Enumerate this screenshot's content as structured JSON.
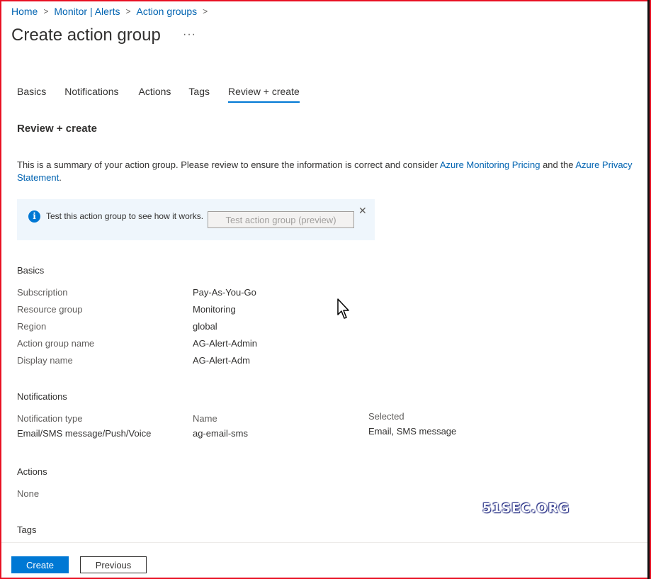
{
  "breadcrumb": {
    "items": [
      "Home",
      "Monitor | Alerts",
      "Action groups"
    ],
    "separator": ">"
  },
  "page": {
    "title": "Create action group",
    "more_label": "···"
  },
  "tabs": [
    {
      "label": "Basics",
      "active": false
    },
    {
      "label": "Notifications",
      "active": false
    },
    {
      "label": "Actions",
      "active": false
    },
    {
      "label": "Tags",
      "active": false
    },
    {
      "label": "Review + create",
      "active": true
    }
  ],
  "review": {
    "title": "Review + create",
    "summary_prefix": "This is a summary of your action group. Please review to ensure the information is correct and consider ",
    "pricing_link": "Azure Monitoring Pricing",
    "summary_mid": " and the ",
    "privacy_link": "Azure Privacy Statement",
    "summary_suffix": "."
  },
  "infobar": {
    "icon": "info-icon",
    "text": "Test this action group to see how it works.",
    "button": "Test action group (preview)",
    "close": "✕"
  },
  "basics": {
    "title": "Basics",
    "rows": [
      {
        "label": "Subscription",
        "value": "Pay-As-You-Go"
      },
      {
        "label": "Resource group",
        "value": "Monitoring"
      },
      {
        "label": "Region",
        "value": "global"
      },
      {
        "label": "Action group name",
        "value": "AG-Alert-Admin"
      },
      {
        "label": "Display name",
        "value": "AG-Alert-Adm"
      }
    ]
  },
  "notifications": {
    "title": "Notifications",
    "headers": {
      "type": "Notification type",
      "name": "Name",
      "selected": "Selected"
    },
    "row": {
      "type": "Email/SMS message/Push/Voice",
      "name": "ag-email-sms",
      "selected": "Email, SMS message"
    }
  },
  "actions": {
    "title": "Actions",
    "value": "None"
  },
  "tags": {
    "title": "Tags"
  },
  "watermark": "51SEC.ORG",
  "footer": {
    "create": "Create",
    "previous": "Previous"
  },
  "colors": {
    "accent": "#0078d4",
    "link": "#0063b1",
    "frame": "#e81123",
    "info_bg": "#eff6fc"
  }
}
